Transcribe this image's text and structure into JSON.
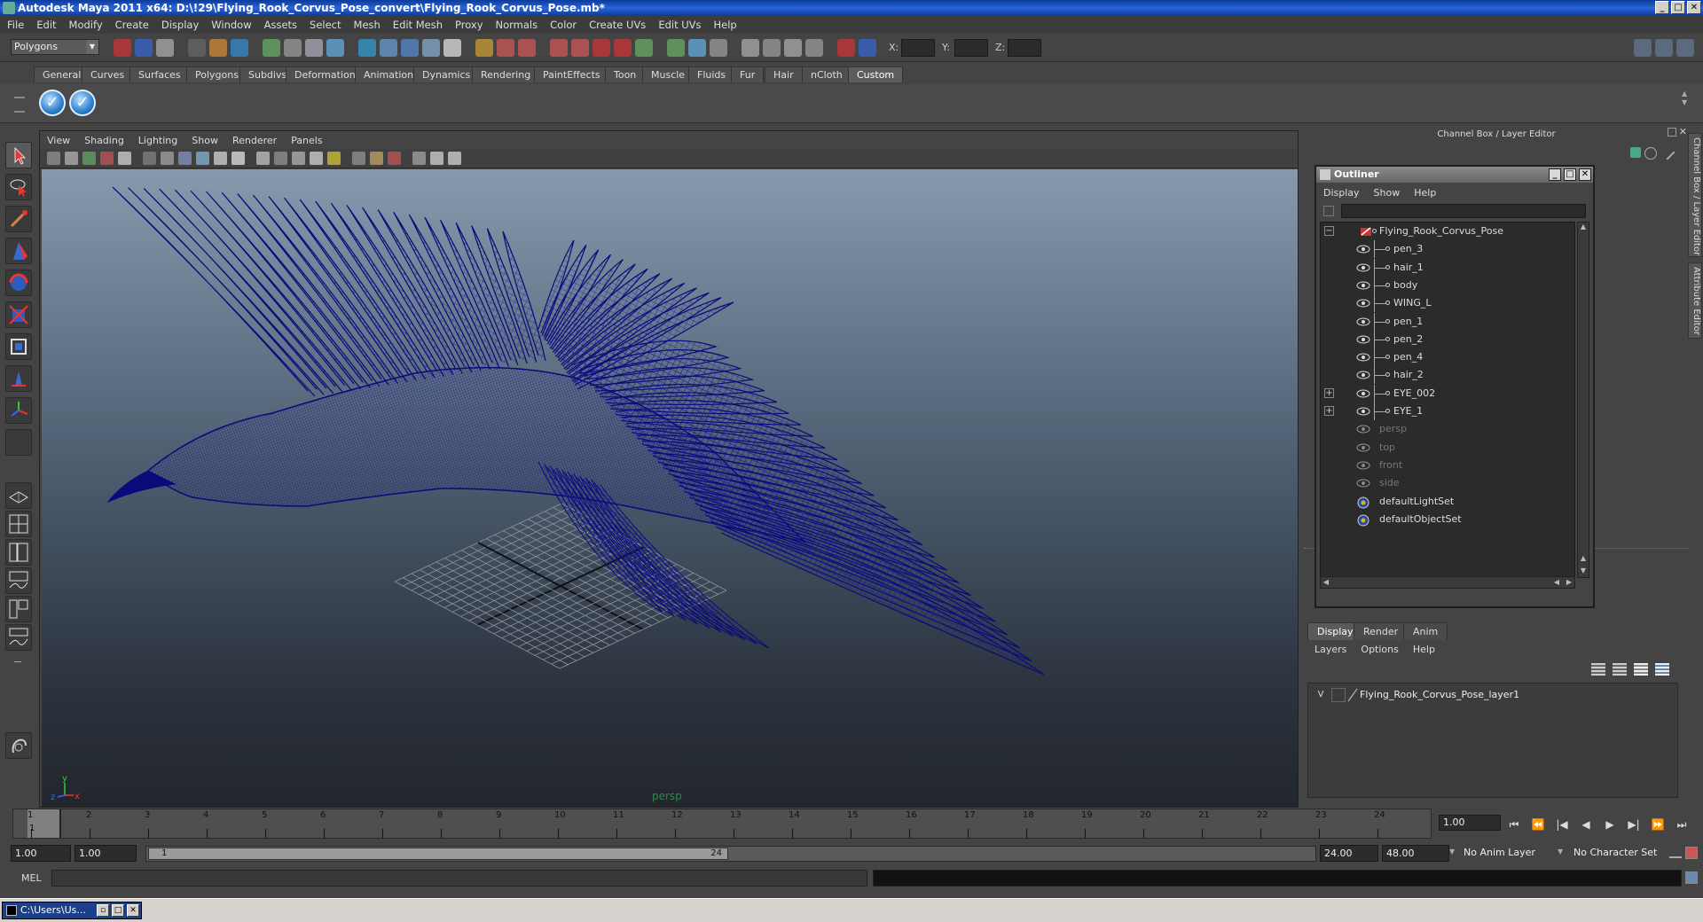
{
  "window": {
    "title": "Autodesk Maya 2011 x64: D:\\!29\\Flying_Rook_Corvus_Pose_convert\\Flying_Rook_Corvus_Pose.mb*",
    "minimize": "_",
    "maximize": "□",
    "close": "✕"
  },
  "menubar": {
    "items": [
      "File",
      "Edit",
      "Modify",
      "Create",
      "Display",
      "Window",
      "Assets",
      "Select",
      "Mesh",
      "Edit Mesh",
      "Proxy",
      "Normals",
      "Color",
      "Create UVs",
      "Edit UVs",
      "Help"
    ]
  },
  "statusline": {
    "mode": "Polygons",
    "coord_x_label": "X:",
    "coord_y_label": "Y:",
    "coord_z_label": "Z:"
  },
  "shelf": {
    "tabs": [
      "General",
      "Curves",
      "Surfaces",
      "Polygons",
      "Subdivs",
      "Deformation",
      "Animation",
      "Dynamics",
      "Rendering",
      "PaintEffects",
      "Toon",
      "Muscle",
      "Fluids",
      "Fur",
      "Hair",
      "nCloth",
      "Custom"
    ],
    "active_tab": "Custom",
    "buttons": [
      "check-button-1",
      "check-button-2"
    ]
  },
  "viewport": {
    "menu": [
      "View",
      "Shading",
      "Lighting",
      "Show",
      "Renderer",
      "Panels"
    ],
    "camera_label": "persp",
    "axis_x": "x",
    "axis_y": "y",
    "axis_z": "z",
    "wire_color": "#0a0a7a"
  },
  "right_panel": {
    "title": "Channel Box / Layer Editor",
    "side_tabs": [
      "Channel Box / Layer Editor",
      "Attribute Editor"
    ]
  },
  "outliner": {
    "title": "Outliner",
    "menu": [
      "Display",
      "Show",
      "Help"
    ],
    "items": [
      {
        "label": "Flying_Rook_Corvus_Pose",
        "level": 0,
        "expander": "−",
        "dim": false
      },
      {
        "label": "pen_3",
        "level": 1,
        "expander": "",
        "dim": false
      },
      {
        "label": "hair_1",
        "level": 1,
        "expander": "",
        "dim": false
      },
      {
        "label": "body",
        "level": 1,
        "expander": "",
        "dim": false
      },
      {
        "label": "WING_L",
        "level": 1,
        "expander": "",
        "dim": false
      },
      {
        "label": "pen_1",
        "level": 1,
        "expander": "",
        "dim": false
      },
      {
        "label": "pen_2",
        "level": 1,
        "expander": "",
        "dim": false
      },
      {
        "label": "pen_4",
        "level": 1,
        "expander": "",
        "dim": false
      },
      {
        "label": "hair_2",
        "level": 1,
        "expander": "",
        "dim": false
      },
      {
        "label": "EYE_002",
        "level": 1,
        "expander": "+",
        "dim": false
      },
      {
        "label": "EYE_1",
        "level": 1,
        "expander": "+",
        "dim": false
      },
      {
        "label": "persp",
        "level": 0,
        "expander": "",
        "dim": true
      },
      {
        "label": "top",
        "level": 0,
        "expander": "",
        "dim": true
      },
      {
        "label": "front",
        "level": 0,
        "expander": "",
        "dim": true
      },
      {
        "label": "side",
        "level": 0,
        "expander": "",
        "dim": true
      },
      {
        "label": "defaultLightSet",
        "level": 0,
        "expander": "",
        "dim": false
      },
      {
        "label": "defaultObjectSet",
        "level": 0,
        "expander": "",
        "dim": false
      }
    ]
  },
  "layer_editor": {
    "tabs": [
      "Display",
      "Render",
      "Anim"
    ],
    "active_tab": "Display",
    "menu": [
      "Layers",
      "Options",
      "Help"
    ],
    "layers": [
      {
        "visible": "V",
        "name": "Flying_Rook_Corvus_Pose_layer1"
      }
    ]
  },
  "timeline": {
    "ticks": [
      "1",
      "2",
      "3",
      "4",
      "5",
      "6",
      "7",
      "8",
      "9",
      "10",
      "11",
      "12",
      "13",
      "14",
      "15",
      "16",
      "17",
      "18",
      "19",
      "20",
      "21",
      "22",
      "23",
      "24"
    ],
    "current_frame_marker": "1",
    "current_frame": "1.00",
    "playback_buttons": [
      "⏮",
      "⏪",
      "|◀",
      "◀",
      "▶",
      "▶|",
      "⏩",
      "⏭"
    ]
  },
  "range": {
    "start_time": "1.00",
    "playback_start": "1.00",
    "handle_start": "1",
    "handle_end": "24",
    "playback_end": "24.00",
    "end_time": "48.00",
    "anim_layer": "No Anim Layer",
    "character_set": "No Character Set"
  },
  "command_line": {
    "label": "MEL"
  },
  "taskbar": {
    "task_label": "C:\\Users\\Us..."
  }
}
